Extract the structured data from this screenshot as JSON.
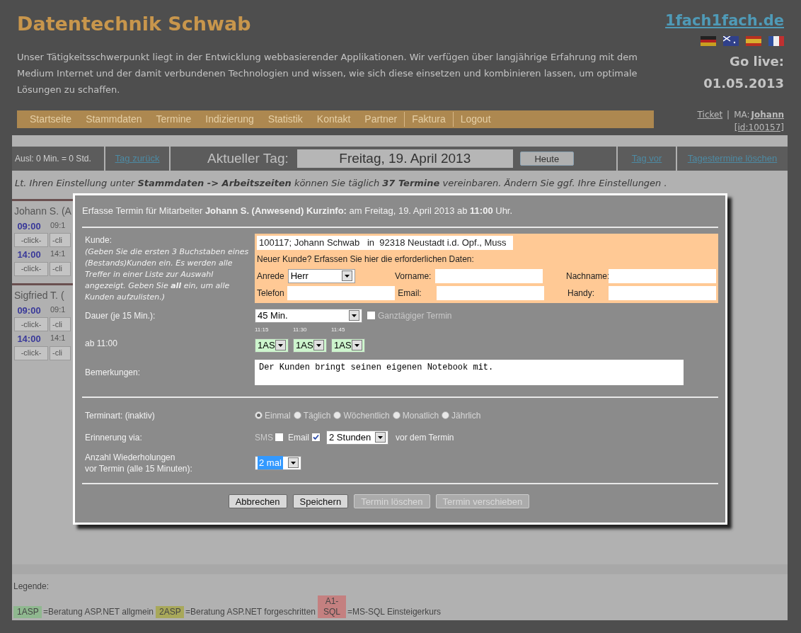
{
  "header": {
    "title": "Datentechnik Schwab",
    "description": "Unser Tätigkeitsschwerpunkt liegt in der Entwicklung webbasierender Applikationen. Wir verfügen über langjährige Erfahrung mit dem Medium Internet und der damit verbundenen Technologien und wissen, wie sich diese einsetzen und kombinieren lassen, um optimale Lösungen zu schaffen.",
    "nav": [
      "Startseite",
      "Stammdaten",
      "Termine",
      "Indizierung",
      "Statistik",
      "Kontakt",
      "Partner",
      "Faktura",
      "Logout"
    ],
    "site_link": "1fach1fach.de",
    "go_live": "Go live:",
    "go_live_date": "01.05.2013",
    "ticket": "Ticket",
    "separator": "|",
    "ma_label": "MA:",
    "ma_name": "Johann",
    "user_id": "[id:100157]"
  },
  "toolbar": {
    "balance": "Ausl: 0 Min. = 0 Std.",
    "prev": "Tag zurück",
    "current_label": "Aktueller Tag:",
    "date": "Freitag, 19. April 2013",
    "today": "Heute",
    "next": "Tag vor",
    "delete": "Tagestermine löschen"
  },
  "info": "Lt. Ihren Einstellung unter **Stammdaten -> Arbeitszeiten** können Sie täglich **37 Termine** vereinbaren. Ändern Sie ggf. Ihre Einstellungen .",
  "staff": [
    {
      "name": "Johann S. (A",
      "rows": [
        {
          "time": "09:00",
          "next_time": "09:1",
          "slot": "-click-",
          "next_slot": "-cli"
        },
        {
          "time": "14:00",
          "next_time": "14:1",
          "slot": "-click-",
          "next_slot": "-cli"
        }
      ]
    },
    {
      "name": "Sigfried T. (",
      "rows": [
        {
          "time": "09:00",
          "next_time": "09:1",
          "slot": "-click-",
          "next_slot": "-cli"
        },
        {
          "time": "14:00",
          "next_time": "14:1",
          "slot": "-click-",
          "next_slot": "-cli"
        }
      ]
    }
  ],
  "modal": {
    "title": "Erfasse Termin für Mitarbeiter **Johann S. (Anwesend) Kurzinfo:** am Freitag, 19. April 2013 ab **11:00** Uhr.",
    "customer_label": "Kunde:",
    "customer_hint": "(Geben Sie die ersten 3 Buchstaben eines (Bestands)Kunden ein. Es werden alle Treffer in einer Liste zur Auswahl angezeigt. Geben Sie **all** ein, um alle Kunden aufzulisten.)",
    "customer_value": "100117; Johann Schwab   in  92318 Neustadt i.d. Opf., Muss",
    "new_customer": "Neuer Kunde? Erfassen Sie hier die erforderlichen Daten:",
    "salutation_label": "Anrede",
    "salutation": "Herr",
    "firstname_label": "Vorname:",
    "lastname_label": "Nachname:",
    "phone_label": "Telefon",
    "email_label": "Email:",
    "mobile_label": "Handy:",
    "duration_label": "Dauer (je 15 Min.):",
    "duration": "45 Min.",
    "allday": {
      "label": "Ganztägiger Termin",
      "checked": false
    },
    "start_label": "ab 11:00",
    "slots": [
      {
        "time": "11:15",
        "value": "1AS"
      },
      {
        "time": "11:30",
        "value": "1AS"
      },
      {
        "time": "11:45",
        "value": "1AS"
      }
    ],
    "remarks_label": "Bemerkungen:",
    "remarks": "Der Kunden bringt seinen eigenen Notebook mit.",
    "type_label": "Terminart: (inaktiv)",
    "types": [
      {
        "label": "Einmal",
        "selected": true
      },
      {
        "label": "Täglich",
        "selected": false
      },
      {
        "label": "Wöchentlich",
        "selected": false
      },
      {
        "label": "Monatlich",
        "selected": false
      },
      {
        "label": "Jährlich",
        "selected": false
      }
    ],
    "reminder_label": "Erinnerung via:",
    "sms": {
      "label": "SMS",
      "checked": false
    },
    "email": {
      "label": "Email",
      "checked": true
    },
    "reminder_time": "2 Stunden",
    "reminder_suffix": "vor dem Termin",
    "repeat_label": [
      "Anzahl Wiederholungen",
      "vor Termin (alle 15 Minuten):"
    ],
    "repeat": "2 mal",
    "buttons": [
      {
        "label": "Abbrechen",
        "disabled": false
      },
      {
        "label": "Speichern",
        "disabled": false
      },
      {
        "label": "Termin löschen",
        "disabled": true
      },
      {
        "label": "Termin verschieben",
        "disabled": true
      }
    ]
  },
  "legend": {
    "label": "Legende:",
    "items": [
      {
        "code": "1ASP",
        "text": "=Beratung ASP.NET allgmein",
        "color": "#8fb88f"
      },
      {
        "code": "2ASP",
        "text": "=Beratung ASP.NET forgeschritten",
        "color": "#a8a85a"
      },
      {
        "code": "A1-SQL",
        "text": "=MS-SQL Einsteigerkurs",
        "color": "#c48080"
      }
    ]
  }
}
